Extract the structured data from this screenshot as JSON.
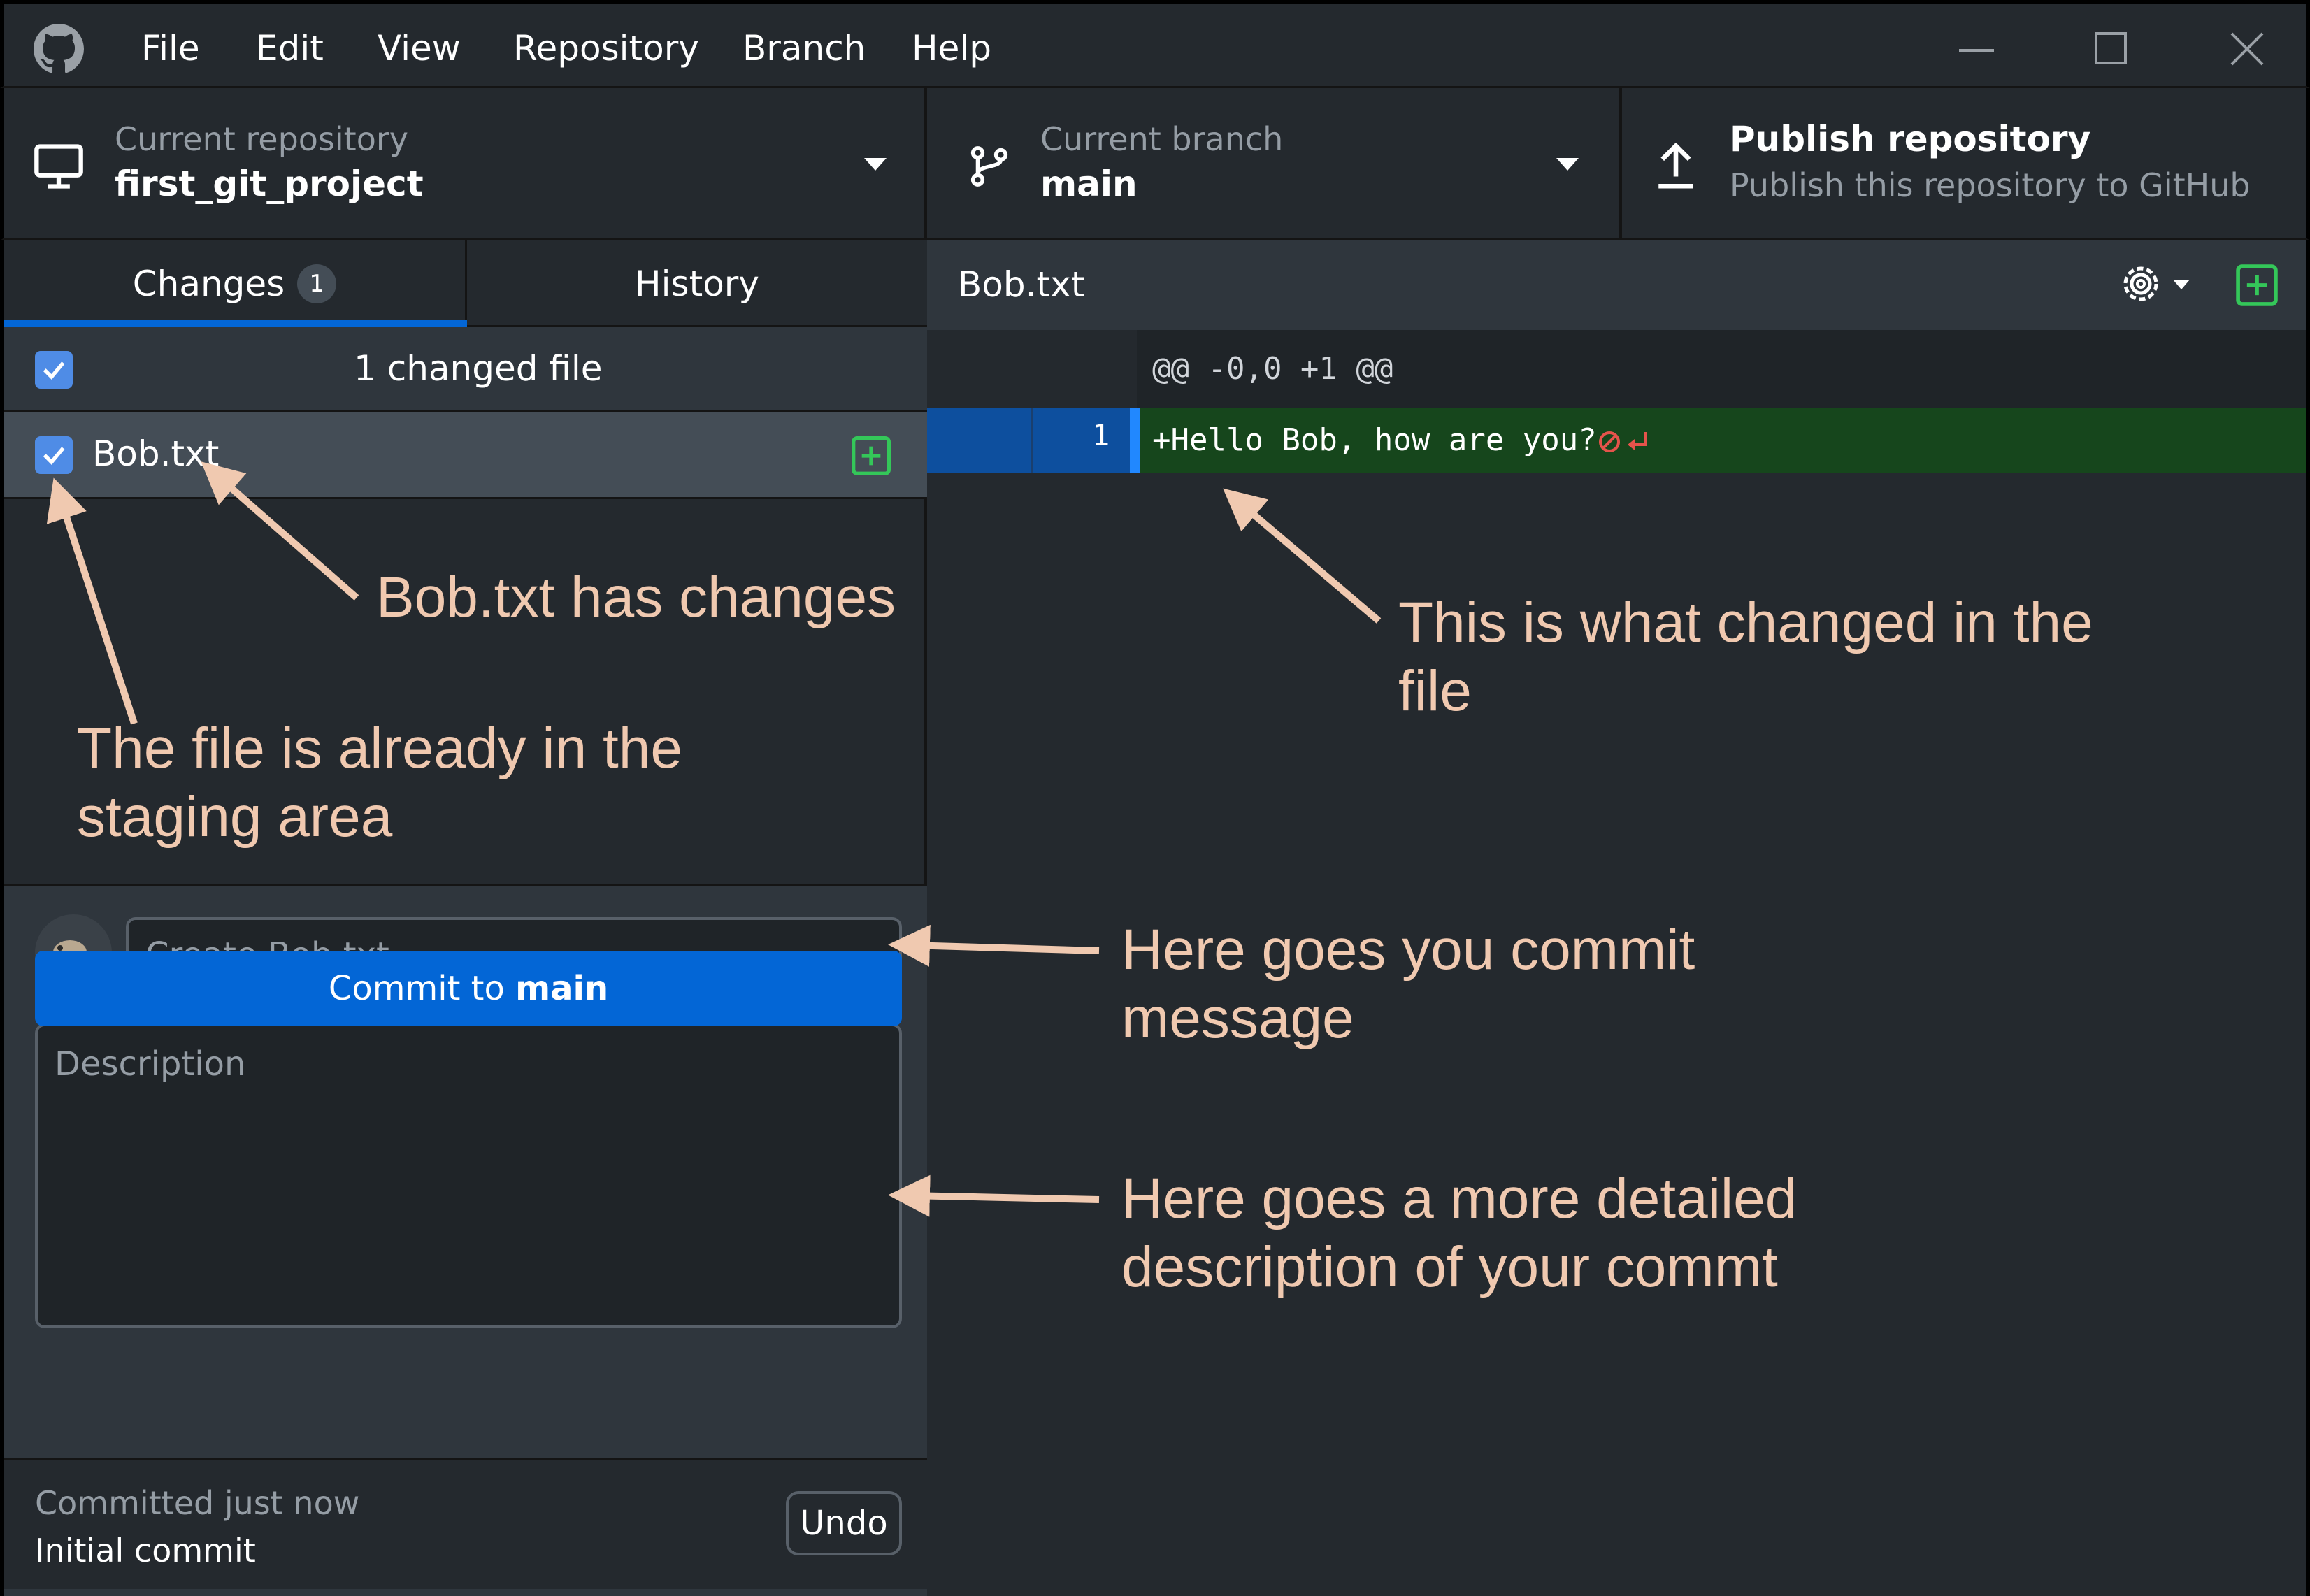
{
  "menu": {
    "items": [
      "File",
      "Edit",
      "View",
      "Repository",
      "Branch",
      "Help"
    ]
  },
  "toolbar": {
    "repository": {
      "label": "Current repository",
      "value": "first_git_project"
    },
    "branch": {
      "label": "Current branch",
      "value": "main"
    },
    "publish": {
      "title": "Publish repository",
      "subtitle": "Publish this repository to GitHub"
    }
  },
  "tabs": {
    "changes": {
      "label": "Changes",
      "count": "1"
    },
    "history": {
      "label": "History"
    }
  },
  "changes": {
    "summary": "1 changed file",
    "files": [
      {
        "name": "Bob.txt",
        "status": "added"
      }
    ]
  },
  "commit": {
    "summary_value": "Create Bob.txt",
    "description_placeholder": "Description",
    "button_prefix": "Commit to ",
    "button_branch": "main"
  },
  "last_commit": {
    "status": "Committed just now",
    "message": "Initial commit",
    "undo_label": "Undo"
  },
  "diff": {
    "filename": "Bob.txt",
    "hunk_header": "@@ -0,0 +1 @@",
    "lines": [
      {
        "number": "1",
        "text": "+Hello Bob, how are you?"
      }
    ]
  },
  "annotations": {
    "has_changes": "Bob.txt has changes",
    "staging_line1": "The file is already in the",
    "staging_line2": "staging area",
    "what_changed_line1": "This is what changed in the",
    "what_changed_line2": "file",
    "commit_msg_line1": "Here goes you commit",
    "commit_msg_line2": "message",
    "description_line1": "Here goes a more detailed",
    "description_line2": "description of your commt"
  },
  "colors": {
    "accent": "#0366d6",
    "added_bg": "#16461c",
    "annotation": "#f0c9b0"
  }
}
